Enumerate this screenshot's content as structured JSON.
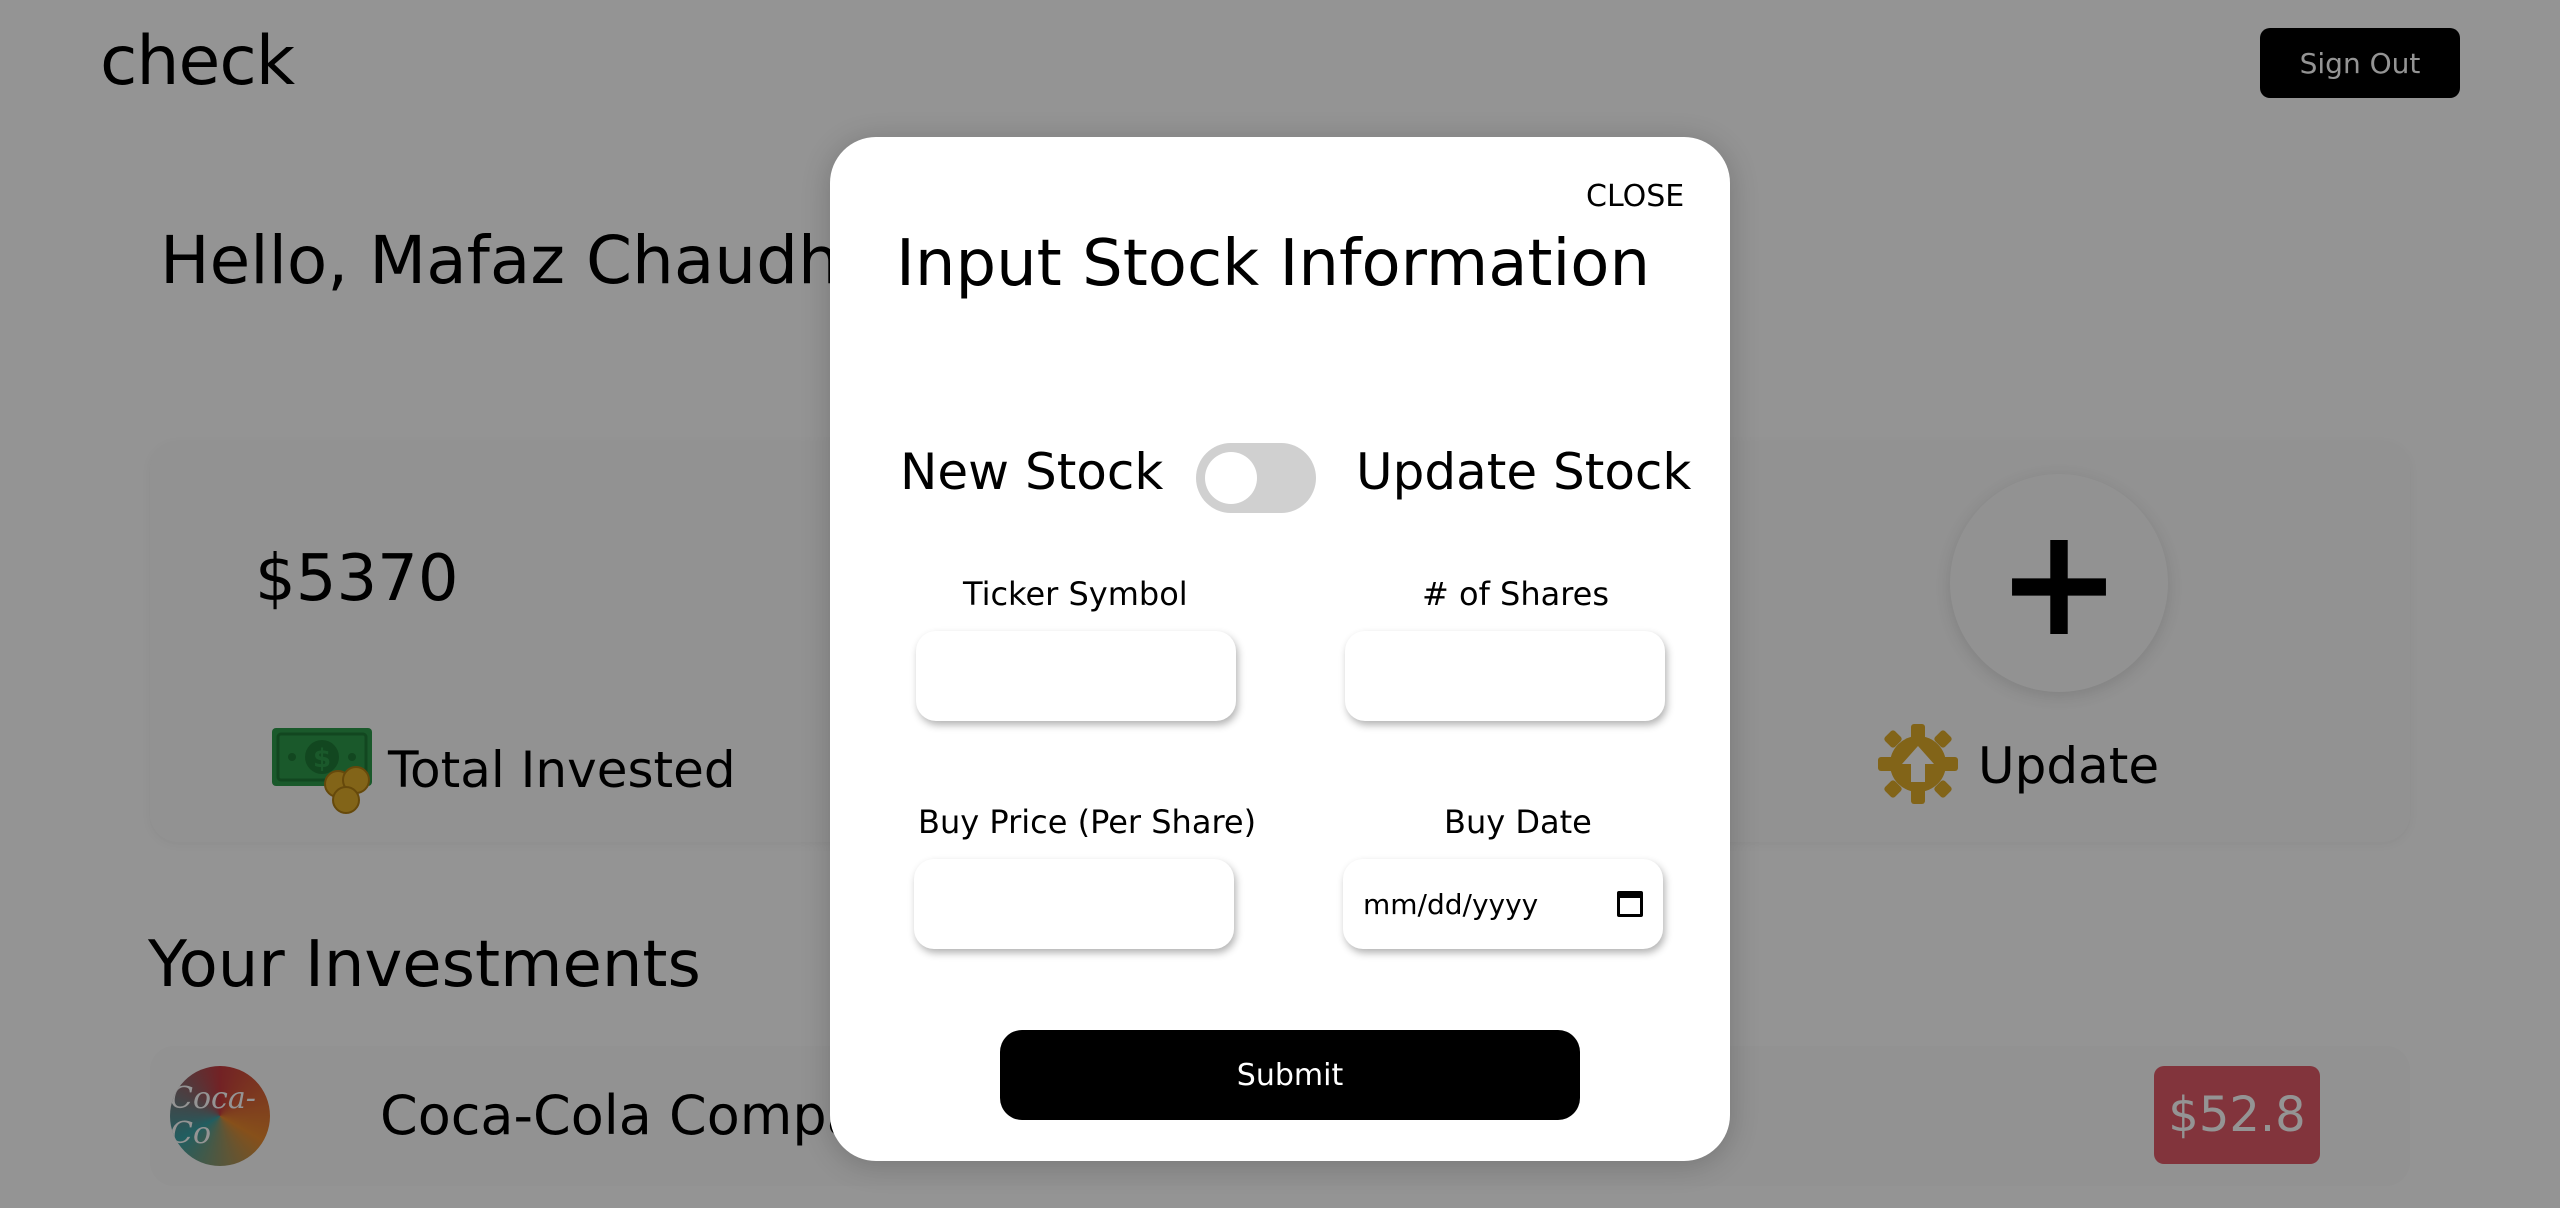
{
  "header": {
    "brand": "check",
    "sign_out_label": "Sign Out"
  },
  "greeting": "Hello, Mafaz Chaudhr",
  "summary_cards": {
    "total_invested": {
      "value": "$5370",
      "label": "Total Invested",
      "icon": "money-icon"
    },
    "update": {
      "plus": "+",
      "label": "Update",
      "icon": "gear-upload-icon"
    }
  },
  "investments": {
    "title": "Your Investments",
    "items": [
      {
        "name": "Coca-Cola Compa",
        "logo_text": "Coca-Co",
        "price": "$52.8",
        "price_color": "#e15a68"
      }
    ]
  },
  "modal": {
    "close_label": "CLOSE",
    "title": "Input Stock Information",
    "toggle": {
      "left_label": "New Stock",
      "right_label": "Update Stock",
      "state": "off"
    },
    "fields": {
      "ticker_label": "Ticker Symbol",
      "shares_label": "# of Shares",
      "buy_price_label": "Buy Price (Per Share)",
      "buy_date_label": "Buy Date",
      "buy_date_placeholder": "mm/dd/yyyy"
    },
    "submit_label": "Submit"
  },
  "colors": {
    "overlay": "rgba(0,0,0,0.42)",
    "button_bg": "#000000",
    "price_badge": "#e15a68",
    "toggle_off": "#d0d0d0",
    "money_green": "#2e9a4a",
    "gold": "#e0ad2a"
  }
}
